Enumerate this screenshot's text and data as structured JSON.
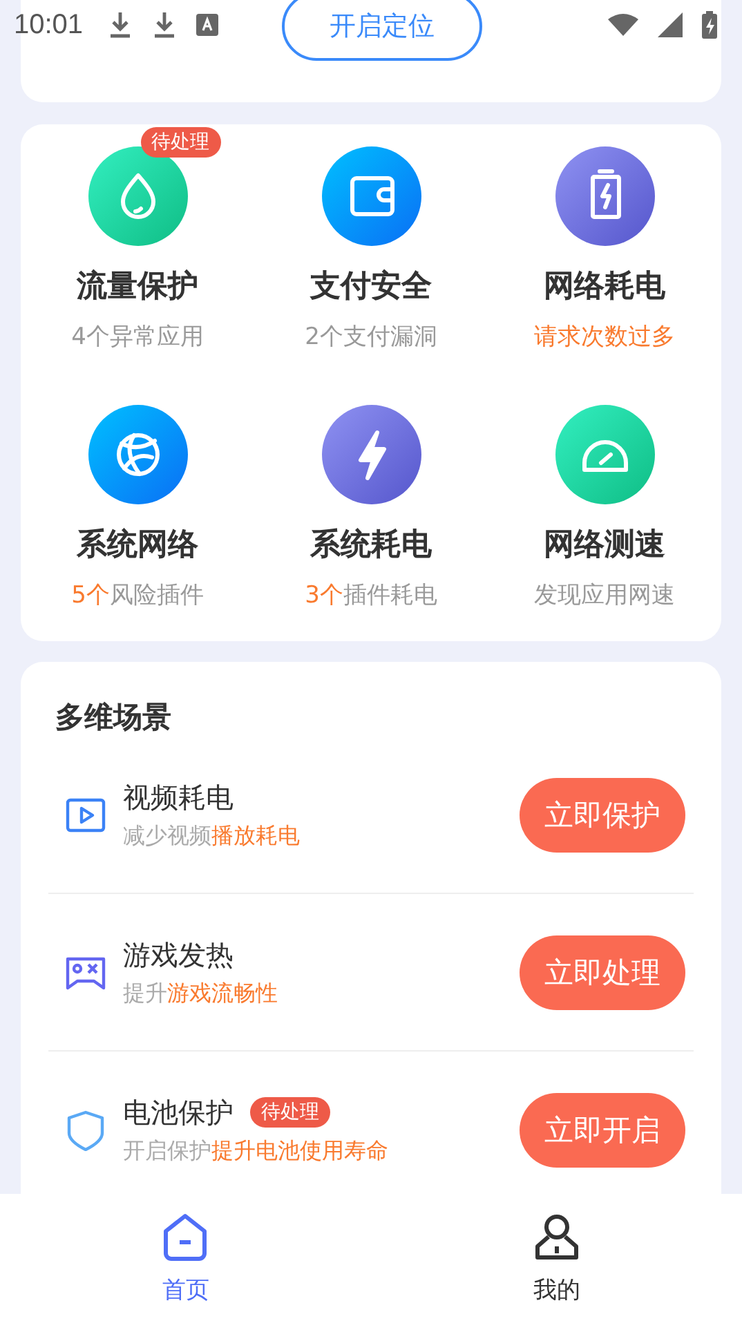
{
  "status_bar": {
    "time": "10:01"
  },
  "location": {
    "button": "开启定位"
  },
  "tiles": [
    {
      "kind": "drop",
      "title": "流量保护",
      "badge": "待处理",
      "subtitle": [
        {
          "text": "4个异常应用",
          "highlight": false
        }
      ]
    },
    {
      "kind": "wallet",
      "title": "支付安全",
      "subtitle": [
        {
          "text": "2个支付漏洞",
          "highlight": false
        }
      ]
    },
    {
      "kind": "battery",
      "title": "网络耗电",
      "subtitle": [
        {
          "text": "请求次数过多",
          "highlight": true
        }
      ]
    },
    {
      "kind": "globe",
      "title": "系统网络",
      "subtitle": [
        {
          "text": "5个",
          "highlight": true
        },
        {
          "text": "风险插件",
          "highlight": false
        }
      ]
    },
    {
      "kind": "bolt",
      "title": "系统耗电",
      "subtitle": [
        {
          "text": "3个",
          "highlight": true
        },
        {
          "text": "插件耗电",
          "highlight": false
        }
      ]
    },
    {
      "kind": "gauge",
      "title": "网络测速",
      "subtitle": [
        {
          "text": "发现应用网速",
          "highlight": false
        }
      ]
    }
  ],
  "scenes": {
    "title": "多维场景",
    "items": [
      {
        "kind": "video",
        "title": "视频耗电",
        "subtitle": [
          {
            "text": "减少视频",
            "highlight": false
          },
          {
            "text": "播放耗电",
            "highlight": true
          }
        ],
        "button": "立即保护"
      },
      {
        "kind": "game",
        "title": "游戏发热",
        "subtitle": [
          {
            "text": "提升",
            "highlight": false
          },
          {
            "text": "游戏流畅性",
            "highlight": true
          }
        ],
        "button": "立即处理"
      },
      {
        "kind": "shield",
        "title": "电池保护",
        "badge": "待处理",
        "subtitle": [
          {
            "text": "开启保护",
            "highlight": false
          },
          {
            "text": "提升电池使用寿命",
            "highlight": true
          }
        ],
        "button": "立即开启"
      }
    ]
  },
  "bottom_nav": [
    {
      "kind": "home",
      "label": "首页",
      "selected": true
    },
    {
      "kind": "person",
      "label": "我的",
      "selected": false
    }
  ]
}
